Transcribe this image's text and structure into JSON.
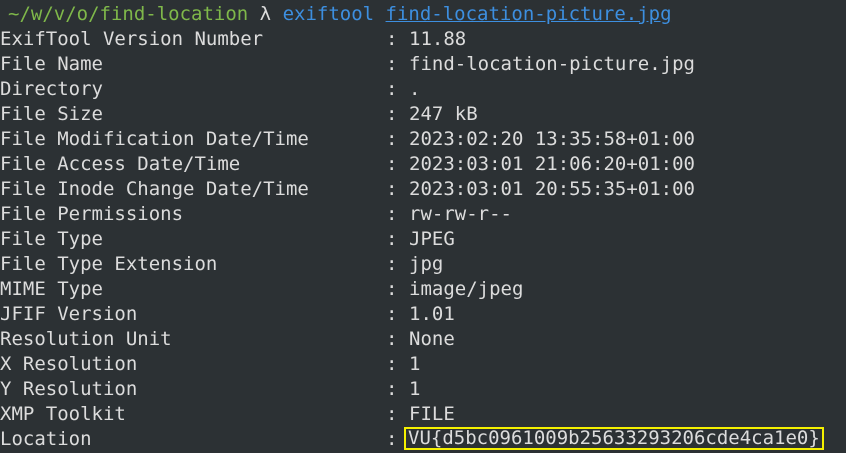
{
  "prompt": {
    "cwd": "~/w/v/o/find-location",
    "lambda": "λ",
    "command": "exiftool",
    "argument": "find-location-picture.jpg"
  },
  "separator": ":",
  "rows": [
    {
      "key": "ExifTool Version Number",
      "value": "11.88"
    },
    {
      "key": "File Name",
      "value": "find-location-picture.jpg"
    },
    {
      "key": "Directory",
      "value": "."
    },
    {
      "key": "File Size",
      "value": "247 kB"
    },
    {
      "key": "File Modification Date/Time",
      "value": "2023:02:20 13:35:58+01:00"
    },
    {
      "key": "File Access Date/Time",
      "value": "2023:03:01 21:06:20+01:00"
    },
    {
      "key": "File Inode Change Date/Time",
      "value": "2023:03:01 20:55:35+01:00"
    },
    {
      "key": "File Permissions",
      "value": "rw-rw-r--"
    },
    {
      "key": "File Type",
      "value": "JPEG"
    },
    {
      "key": "File Type Extension",
      "value": "jpg"
    },
    {
      "key": "MIME Type",
      "value": "image/jpeg"
    },
    {
      "key": "JFIF Version",
      "value": "1.01"
    },
    {
      "key": "Resolution Unit",
      "value": "None"
    },
    {
      "key": "X Resolution",
      "value": "1"
    },
    {
      "key": "Y Resolution",
      "value": "1"
    },
    {
      "key": "XMP Toolkit",
      "value": "FILE"
    },
    {
      "key": "Location",
      "value": "VU{d5bc0961009b25633293206cde4ca1e0}"
    }
  ],
  "colors": {
    "background": "#2c3134",
    "text": "#dcdcdc",
    "cwd": "#7fb84a",
    "command": "#3d8fe0",
    "highlight_border": "#f4f000"
  }
}
